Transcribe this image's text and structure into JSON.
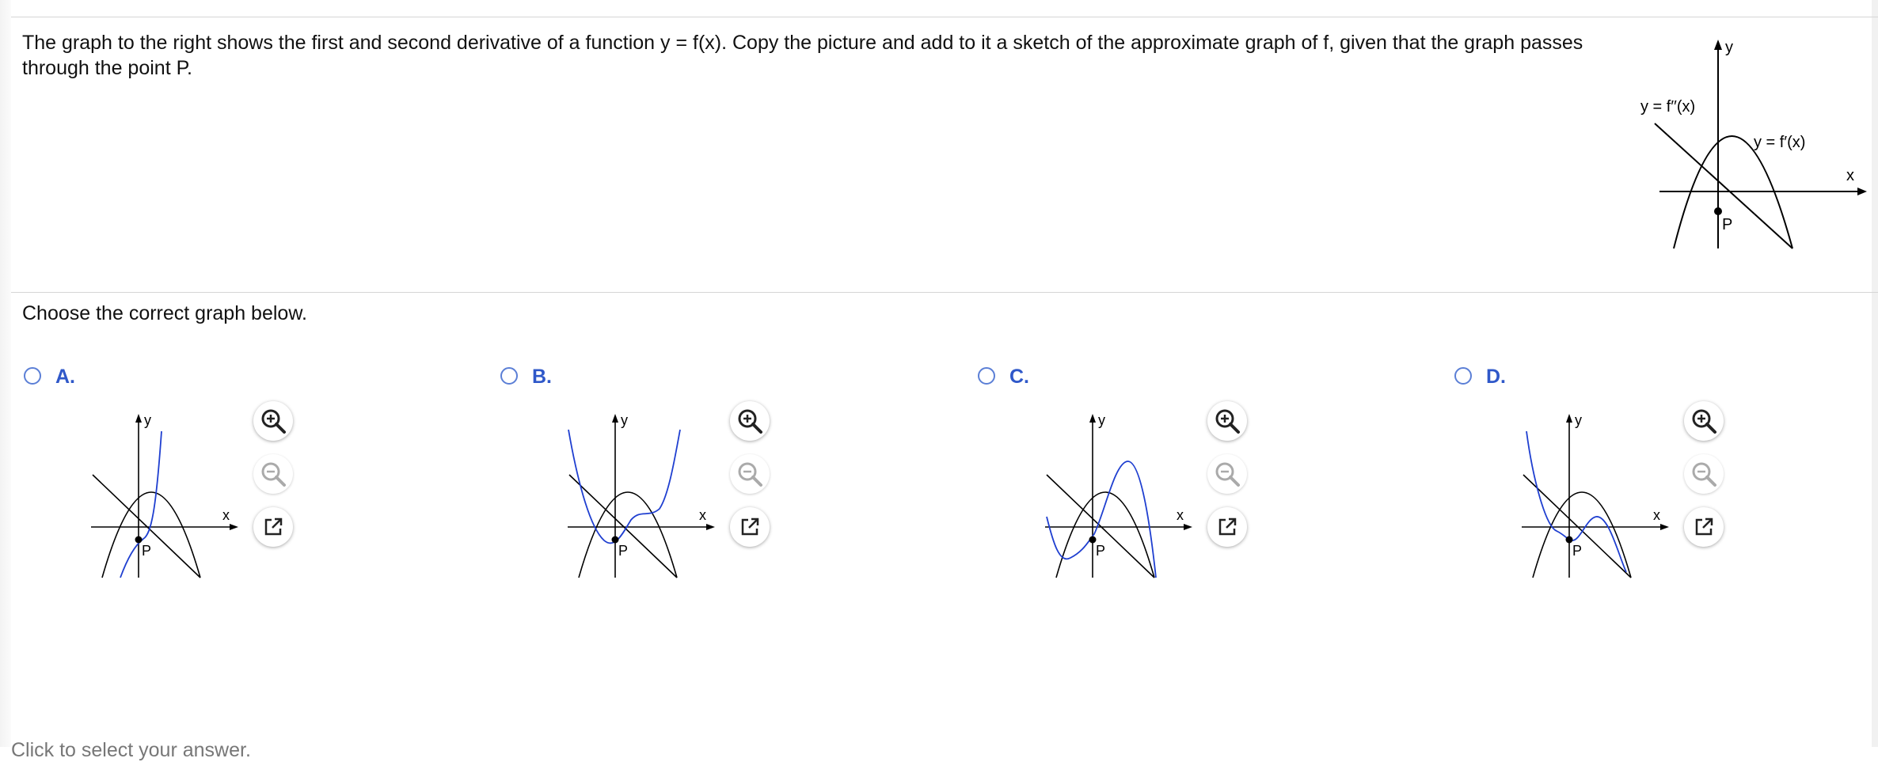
{
  "question": {
    "text": "The graph to the right shows the first and second derivative of a function y = f(x). Copy the picture and add to it a sketch of the approximate graph of f, given that the graph passes through the point P."
  },
  "hero_graph": {
    "y_axis_label": "y",
    "x_axis_label": "x",
    "second_derivative_label": "y = f′′(x)",
    "first_derivative_label": "y = f′(x)",
    "point_label": "P"
  },
  "instruction": "Choose the correct graph below.",
  "choices": [
    {
      "letter": "A.",
      "y_label": "y",
      "x_label": "x",
      "point_label": "P"
    },
    {
      "letter": "B.",
      "y_label": "y",
      "x_label": "x",
      "point_label": "P"
    },
    {
      "letter": "C.",
      "y_label": "y",
      "x_label": "x",
      "point_label": "P"
    },
    {
      "letter": "D.",
      "y_label": "y",
      "x_label": "x",
      "point_label": "P"
    }
  ],
  "tools": {
    "zoom_in": "zoom-in-icon",
    "zoom_out": "zoom-out-icon",
    "popout": "popout-icon"
  },
  "colors": {
    "answer_curve": "#1f3fd0",
    "choice_letter": "#2f58c9",
    "radio_border": "#5b7fd6"
  },
  "footer": "Click to select your answer."
}
